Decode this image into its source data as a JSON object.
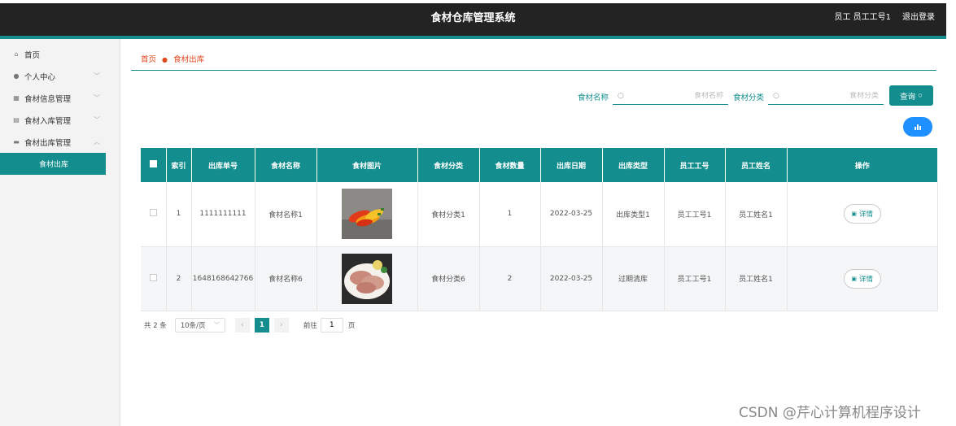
{
  "header": {
    "title": "食材仓库管理系统",
    "user_text": "员工 员工工号1",
    "logout": "退出登录"
  },
  "sidebar": {
    "items": [
      {
        "label": "首页",
        "icon": "home-icon",
        "glyph": "⌂",
        "chevron": false
      },
      {
        "label": "个人中心",
        "icon": "user-icon",
        "glyph": "●",
        "chevron": true
      },
      {
        "label": "食材信息管理",
        "icon": "grid-icon",
        "glyph": "▦",
        "chevron": true
      },
      {
        "label": "食材入库管理",
        "icon": "clipboard-icon",
        "glyph": "▤",
        "chevron": true
      },
      {
        "label": "食材出库管理",
        "icon": "message-icon",
        "glyph": "▬",
        "chevron": true
      }
    ],
    "sub_item": "食材出库"
  },
  "breadcrumb": {
    "home": "首页",
    "current": "食材出库"
  },
  "search": {
    "name_label": "食材名称",
    "name_placeholder": "食材名称",
    "category_label": "食材分类",
    "category_placeholder": "食材分类",
    "query_button": "查询"
  },
  "table": {
    "headers": [
      "",
      "索引",
      "出库单号",
      "食材名称",
      "食材图片",
      "食材分类",
      "食材数量",
      "出库日期",
      "出库类型",
      "员工工号",
      "员工姓名",
      "操作"
    ],
    "rows": [
      {
        "index": "1",
        "order_no": "1111111111",
        "name": "食材名称1",
        "image": "peppers",
        "category": "食材分类1",
        "quantity": "1",
        "date": "2022-03-25",
        "type": "出库类型1",
        "emp_no": "员工工号1",
        "emp_name": "员工姓名1",
        "action": "详情"
      },
      {
        "index": "2",
        "order_no": "1648168642766",
        "name": "食材名称6",
        "image": "meat",
        "category": "食材分类6",
        "quantity": "2",
        "date": "2022-03-25",
        "type": "过期清库",
        "emp_no": "员工工号1",
        "emp_name": "员工姓名1",
        "action": "详情"
      }
    ]
  },
  "pagination": {
    "total": "共 2 条",
    "page_size": "10条/页",
    "prev": "‹",
    "next": "›",
    "current_page": "1",
    "goto_label": "前往",
    "goto_value": "1",
    "page_unit": "页"
  },
  "watermark": "CSDN @芹心计算机程序设计",
  "colors": {
    "accent": "#138d8d",
    "header_bg": "#232323",
    "link": "#e0481e",
    "chart_btn": "#1e90ff"
  }
}
